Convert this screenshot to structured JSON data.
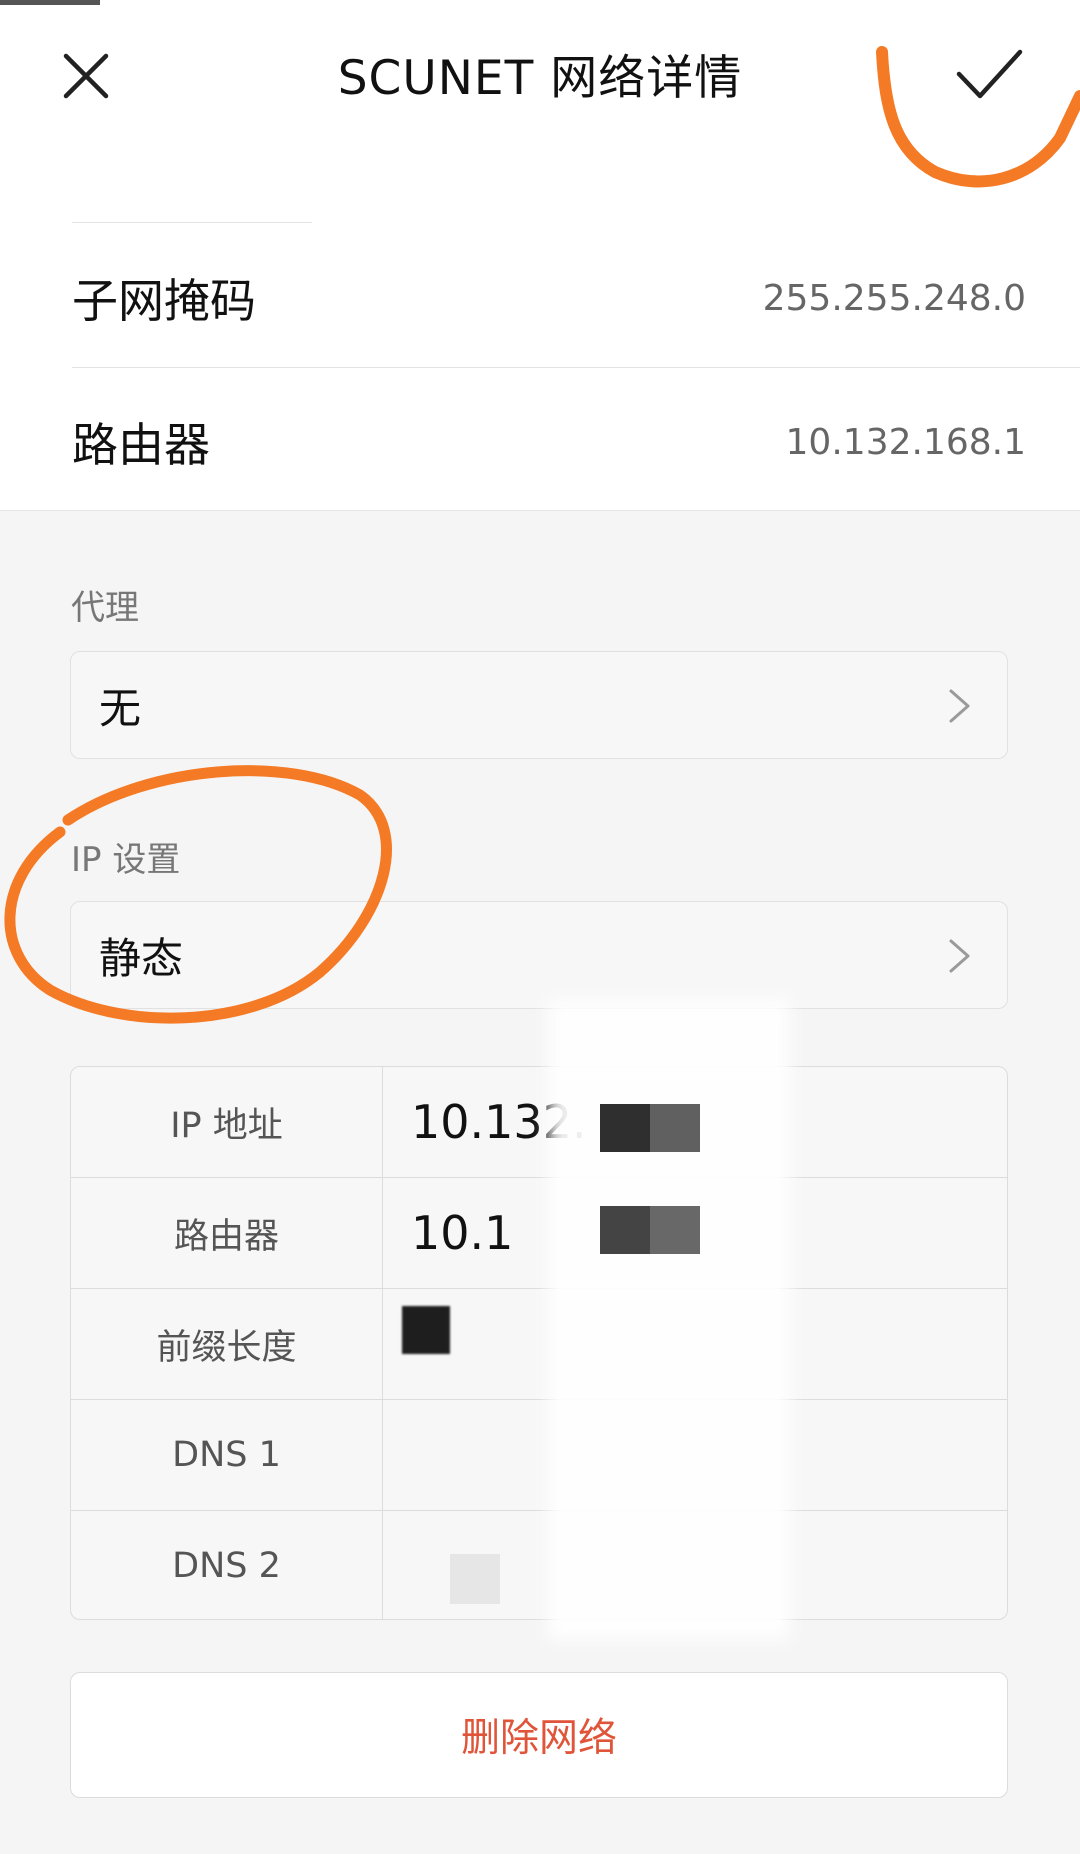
{
  "header": {
    "title": "SCUNET  网络详情",
    "close_icon": "close-icon",
    "confirm_icon": "check-icon"
  },
  "network_info": {
    "rows": [
      {
        "label": "子网掩码",
        "value": "255.255.248.0"
      },
      {
        "label": "路由器",
        "value": "10.132.168.1"
      }
    ]
  },
  "proxy": {
    "section_label": "代理",
    "value": "无"
  },
  "ip_settings": {
    "section_label": "IP 设置",
    "value": "静态"
  },
  "ip_table": {
    "rows": [
      {
        "key": "IP 地址",
        "value": "10.132."
      },
      {
        "key": "路由器",
        "value": "10.1"
      },
      {
        "key": "前缀长度",
        "value": ""
      },
      {
        "key": "DNS 1",
        "value": ""
      },
      {
        "key": "DNS 2",
        "value": ""
      }
    ]
  },
  "delete_button": {
    "label": "删除网络"
  },
  "colors": {
    "accent_red": "#e0553a",
    "annotation_orange": "#f47a25",
    "background": "#f5f5f5"
  }
}
